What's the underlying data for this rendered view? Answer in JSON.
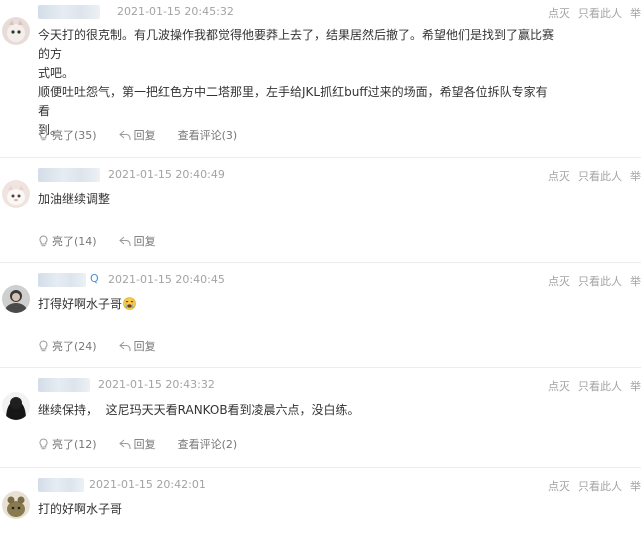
{
  "top_actions": {
    "dim": "点灭",
    "only_him": "只看此人",
    "report": "举"
  },
  "comments": [
    {
      "time": "2021-01-15 20:45:32",
      "paragraphs": [
        "今天打的很克制。有几波操作我都觉得他要莽上去了，结果居然后撤了。希望他们是找到了赢比赛的方",
        "式吧。",
        "顺便吐吐怨气，第一把红色方中二塔那里，左手给JKL抓红buff过来的场面，希望各位拆队专家有看",
        "到。"
      ],
      "like_label": "亮了(35)",
      "reply_label": "回复",
      "view_replies_label": "查看评论(3)"
    },
    {
      "time": "2021-01-15 20:40:49",
      "paragraphs": [
        "加油继续调整"
      ],
      "like_label": "亮了(14)",
      "reply_label": "回复"
    },
    {
      "time": "2021-01-15 20:40:45",
      "paragraphs": [
        "打得好啊水子哥"
      ],
      "like_label": "亮了(24)",
      "reply_label": "回复",
      "verify": "Q",
      "emoji": "crying-face-emoji"
    },
    {
      "time": "2021-01-15 20:43:32",
      "paragraphs": [
        "继续保持，  这尼玛天天看RANKOB看到凌晨六点，没白练。"
      ],
      "like_label": "亮了(12)",
      "reply_label": "回复",
      "view_replies_label": "查看评论(2)"
    },
    {
      "time": "2021-01-15 20:42:01",
      "paragraphs": [
        "打的好啊水子哥"
      ]
    }
  ],
  "colors": {
    "meta_gray": "#a3a3a3",
    "text": "#333333",
    "divider": "#ececec",
    "accent_blue": "#4a90d9"
  }
}
